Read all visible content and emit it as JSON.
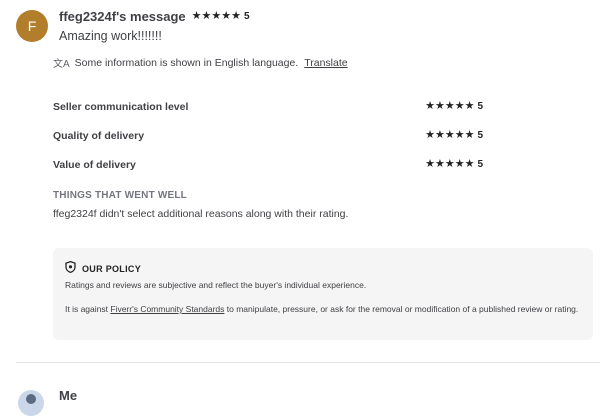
{
  "colors": {
    "avatar_bg": "#b27e2c"
  },
  "review": {
    "avatar_letter": "F",
    "reviewer_message": "ffeg2324f's message",
    "rating": "5",
    "text": "Amazing work!!!!!!!"
  },
  "translation": {
    "icon": "translate-icon",
    "notice": "Some information is shown in English language.",
    "link": "Translate"
  },
  "breakdown": [
    {
      "label": "Seller communication level",
      "rating": "5",
      "stars": 5
    },
    {
      "label": "Quality of delivery",
      "rating": "5",
      "stars": 5
    },
    {
      "label": "Value of delivery",
      "rating": "5",
      "stars": 5
    }
  ],
  "went_well": {
    "title": "THINGS THAT WENT WELL",
    "text": "ffeg2324f didn't select additional reasons along with their rating."
  },
  "policy": {
    "icon": "shield-icon",
    "title": "OUR POLICY",
    "p1": "Ratings and reviews are subjective and reflect the buyer's individual experience.",
    "p2_prefix": "It is against ",
    "p2_link": "Fiverr's Community Standards",
    "p2_suffix": " to manipulate, pressure, or ask for the removal or modification of a published review or rating."
  },
  "next": {
    "name": "Me"
  }
}
